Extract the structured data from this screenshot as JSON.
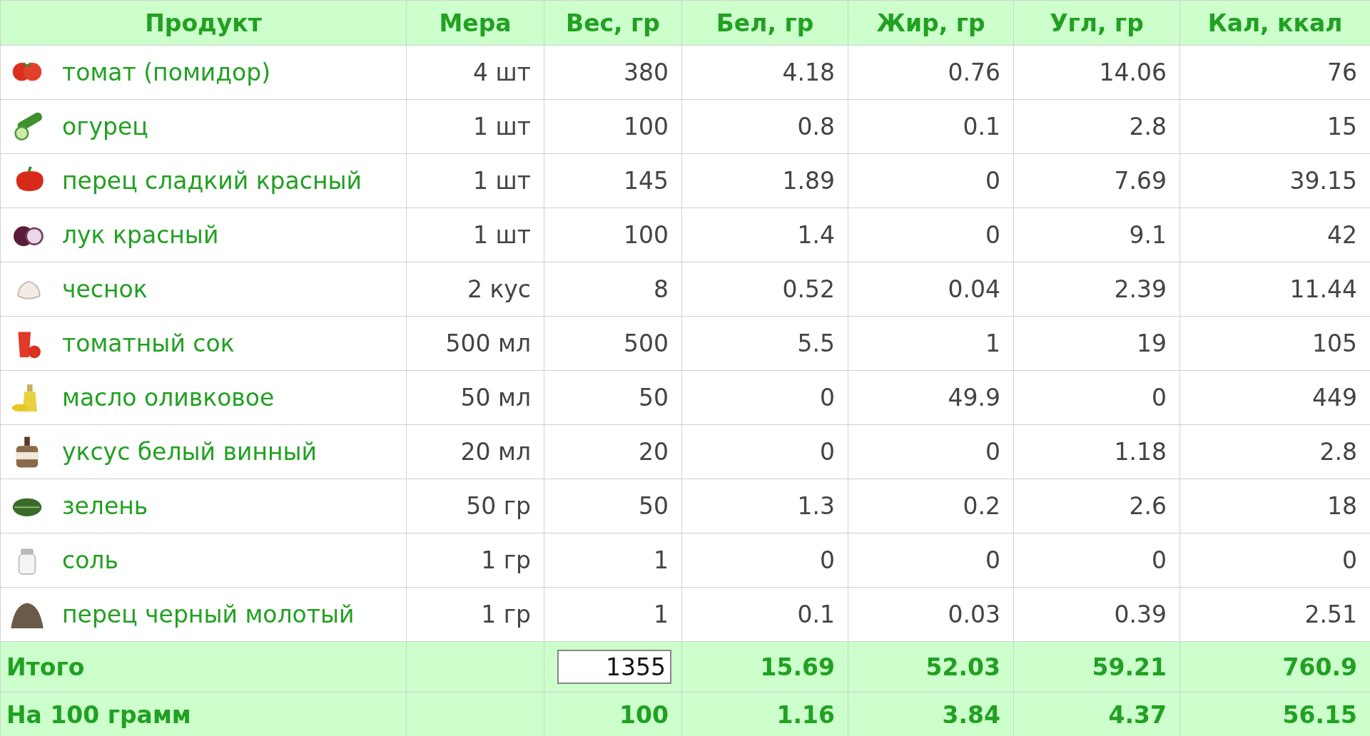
{
  "table": {
    "columns": [
      "Продукт",
      "Мера",
      "Вес, гр",
      "Бел, гр",
      "Жир, гр",
      "Угл, гр",
      "Кал, ккал"
    ],
    "rows": [
      {
        "product": "томат (помидор)",
        "measure": "4 шт",
        "weight": "380",
        "protein": "4.18",
        "fat": "0.76",
        "carbs": "14.06",
        "kcal": "76"
      },
      {
        "product": "огурец",
        "measure": "1 шт",
        "weight": "100",
        "protein": "0.8",
        "fat": "0.1",
        "carbs": "2.8",
        "kcal": "15"
      },
      {
        "product": "перец сладкий красный",
        "measure": "1 шт",
        "weight": "145",
        "protein": "1.89",
        "fat": "0",
        "carbs": "7.69",
        "kcal": "39.15"
      },
      {
        "product": "лук красный",
        "measure": "1 шт",
        "weight": "100",
        "protein": "1.4",
        "fat": "0",
        "carbs": "9.1",
        "kcal": "42"
      },
      {
        "product": "чеснок",
        "measure": "2 кус",
        "weight": "8",
        "protein": "0.52",
        "fat": "0.04",
        "carbs": "2.39",
        "kcal": "11.44"
      },
      {
        "product": "томатный сок",
        "measure": "500 мл",
        "weight": "500",
        "protein": "5.5",
        "fat": "1",
        "carbs": "19",
        "kcal": "105"
      },
      {
        "product": "масло оливковое",
        "measure": "50 мл",
        "weight": "50",
        "protein": "0",
        "fat": "49.9",
        "carbs": "0",
        "kcal": "449"
      },
      {
        "product": "уксус белый винный",
        "measure": "20 мл",
        "weight": "20",
        "protein": "0",
        "fat": "0",
        "carbs": "1.18",
        "kcal": "2.8"
      },
      {
        "product": "зелень",
        "measure": "50 гр",
        "weight": "50",
        "protein": "1.3",
        "fat": "0.2",
        "carbs": "2.6",
        "kcal": "18"
      },
      {
        "product": "соль",
        "measure": "1 гр",
        "weight": "1",
        "protein": "0",
        "fat": "0",
        "carbs": "0",
        "kcal": "0"
      },
      {
        "product": "перец черный молотый",
        "measure": "1 гр",
        "weight": "1",
        "protein": "0.1",
        "fat": "0.03",
        "carbs": "0.39",
        "kcal": "2.51"
      }
    ],
    "totals": [
      {
        "kind": "field",
        "label": "Итого",
        "weight": "1355",
        "protein": "15.69",
        "fat": "52.03",
        "carbs": "59.21",
        "kcal": "760.9"
      },
      {
        "kind": "plain",
        "label": "На 100 грамм",
        "weight": "100",
        "protein": "1.16",
        "fat": "3.84",
        "carbs": "4.37",
        "kcal": "56.15"
      }
    ]
  }
}
